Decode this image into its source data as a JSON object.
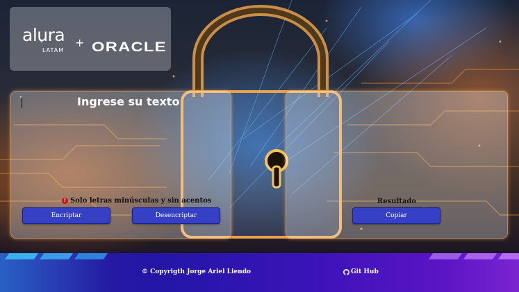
{
  "logo": {
    "alura": "alura",
    "latam": "LATAM",
    "plus": "+",
    "oracle": "ORACLE"
  },
  "input_panel": {
    "title": "Ingrese su texto",
    "hint": "Solo letras minúsculas y sin acentos",
    "hint_icon": "warning-icon",
    "encrypt_label": "Encriptar",
    "decrypt_label": "Desencriptar"
  },
  "output_panel": {
    "result_label": "Resultado",
    "copy_label": "Copiar"
  },
  "footer": {
    "copyright": "© Copyrigth Jorge Ariel Liendo",
    "github_label": "Git Hub",
    "github_icon": "github-icon"
  },
  "colors": {
    "button": "#3640c4",
    "footer_start": "#2a1f9c",
    "footer_end": "#7a24d0",
    "panel_glow": "#e6963c"
  }
}
